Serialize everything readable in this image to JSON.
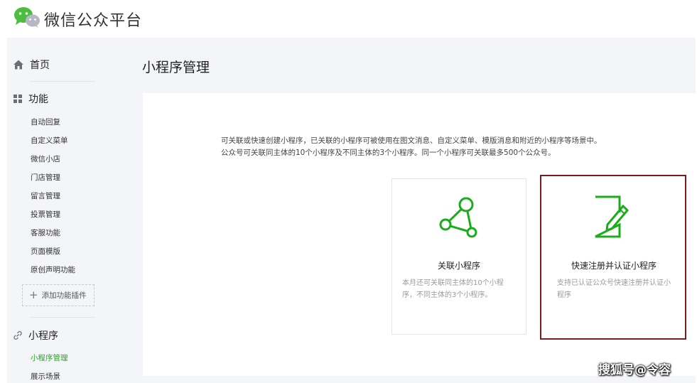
{
  "header": {
    "brand": "微信公众平台",
    "logo_icon": "wechat-logo-icon"
  },
  "sidebar": {
    "home": {
      "label": "首页",
      "icon": "home-icon"
    },
    "features": {
      "label": "功能",
      "icon": "grid-icon",
      "items": [
        "自动回复",
        "自定义菜单",
        "微信小店",
        "门店管理",
        "留言管理",
        "投票管理",
        "客服功能",
        "页面模版",
        "原创声明功能"
      ],
      "add_plugin": "添加功能插件"
    },
    "miniprogram": {
      "label": "小程序",
      "icon": "link-icon",
      "items": [
        "小程序管理",
        "展示场景"
      ],
      "active": "小程序管理"
    }
  },
  "main": {
    "title": "小程序管理",
    "desc_line1": "可关联或快速创建小程序，已关联的小程序可被使用在图文消息、自定义菜单、模版消息和附近的小程序等场景中。",
    "desc_line2": "公众号可关联同主体的10个小程序及不同主体的3个小程序。同一个小程序可关联最多500个公众号。",
    "cards": [
      {
        "title": "关联小程序",
        "desc": "本月还可关联同主体的10个小程序，不同主体的3个小程序。",
        "icon": "share-nodes-icon"
      },
      {
        "title": "快速注册并认证小程序",
        "desc": "支持已认证公众号快速注册并认证小程序",
        "icon": "document-edit-icon"
      }
    ]
  },
  "watermark": "搜狐号@令容",
  "colors": {
    "accent": "#1aad19",
    "highlight_border": "#7a1c1c",
    "background": "#f4f5f9"
  }
}
